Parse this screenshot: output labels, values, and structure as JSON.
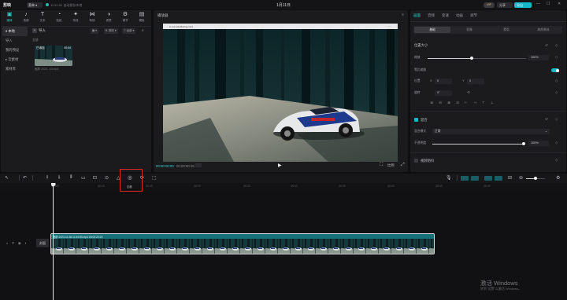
{
  "app": {
    "logo_text": "剪映",
    "menu_label": "菜单 ▾",
    "save_status": "11:51:51 自动保存本地",
    "project_title": "1月11日",
    "vip_label": "VIP",
    "share_label": "分享",
    "export_label": "导出",
    "window_controls": [
      "—",
      "☐",
      "✕"
    ]
  },
  "media_toolbar": [
    {
      "icon": "media-icon",
      "glyph": "▣",
      "label": "媒体",
      "active": true
    },
    {
      "icon": "audio-icon",
      "glyph": "♪",
      "label": "音频"
    },
    {
      "icon": "text-icon",
      "glyph": "T",
      "label": "文本"
    },
    {
      "icon": "sticker-icon",
      "glyph": "◔",
      "label": "贴纸"
    },
    {
      "icon": "effects-icon",
      "glyph": "✦",
      "label": "特效"
    },
    {
      "icon": "transition-icon",
      "glyph": "⋈",
      "label": "转场"
    },
    {
      "icon": "filter-icon",
      "glyph": "◑",
      "label": "滤镜"
    },
    {
      "icon": "adjust-icon",
      "glyph": "⚙",
      "label": "调节"
    },
    {
      "icon": "template-icon",
      "glyph": "▤",
      "label": "模板"
    }
  ],
  "side_nav": [
    {
      "label": "▾ 本地",
      "active": true
    },
    {
      "label": "导入"
    },
    {
      "label": "我的预设"
    },
    {
      "label": "▸ 云素材"
    },
    {
      "label": "素材库"
    }
  ],
  "media_panel": {
    "import_label": "导入",
    "view_label": "▦ ▾",
    "sort_label": "⇅ 排序 ▾",
    "filter_label": "▽ 全部 ▾",
    "search_icon": "⌕",
    "folder_label": "全部",
    "item": {
      "added_label": "已添加",
      "duration": "00:04",
      "name": "截屏 2023...43.mp4"
    }
  },
  "player": {
    "title": "播放器",
    "menu_glyph": "≡",
    "video_bar_text": "● ● ● AutoRacing.mp4",
    "time_current": "00:00:00:00",
    "time_total": "00:00:00:29",
    "play_glyph": "▶",
    "ratio_label": "比例",
    "fit_glyph": "⛶",
    "full_glyph": "⤢"
  },
  "inspector": {
    "tabs": [
      {
        "label": "画面",
        "active": true
      },
      {
        "label": "音频"
      },
      {
        "label": "变速"
      },
      {
        "label": "动画"
      },
      {
        "label": "调节"
      }
    ],
    "sub_tabs": [
      {
        "label": "基础",
        "active": true
      },
      {
        "label": "抠像"
      },
      {
        "label": "蒙版"
      },
      {
        "label": "美颜美体"
      }
    ],
    "position_size_label": "位置大小",
    "scale_label": "缩放",
    "scale_value": "100%",
    "scale_fraction": 0.45,
    "uniform_scale_label": "等比缩放",
    "position_label": "位置",
    "pos_x_label": "X",
    "pos_x": "0",
    "pos_y_label": "Y",
    "pos_y": "0",
    "rotate_label": "旋转",
    "rotate_value": "0°",
    "align_icons": [
      "⊞",
      "⊟",
      "⊠",
      "⊡",
      "⊢",
      "⊣",
      "⊤",
      "⊥"
    ],
    "blend_label": "混合",
    "blend_mode_label": "混合模式",
    "blend_mode_value": "正常",
    "opacity_label": "不透明度",
    "opacity_value": "100%",
    "opacity_fraction": 1.0,
    "stabilize_label": "视频防抖"
  },
  "timeline": {
    "freeze_label": "定格",
    "ruler_ticks": [
      "00:00",
      "|00:10",
      "|00:15",
      "|00:20",
      "|00:25",
      "|00:30",
      "|00:35",
      "|00:40",
      "|00:45",
      "|00:50"
    ],
    "cover_label": "封面",
    "clip_name": "截屏 2023-11-28 11:54:53.mp4  00:00:20:23",
    "track_icons": [
      "◐",
      "🔒",
      "👁",
      "🔊"
    ]
  },
  "watermark": {
    "title": "激活 Windows",
    "subtitle": "转到\"设置\"以激活 Windows。"
  },
  "colors": {
    "accent": "#2fd3d0",
    "export": "#14b8c8",
    "highlight": "#e0281f",
    "clip": "#12454d"
  }
}
